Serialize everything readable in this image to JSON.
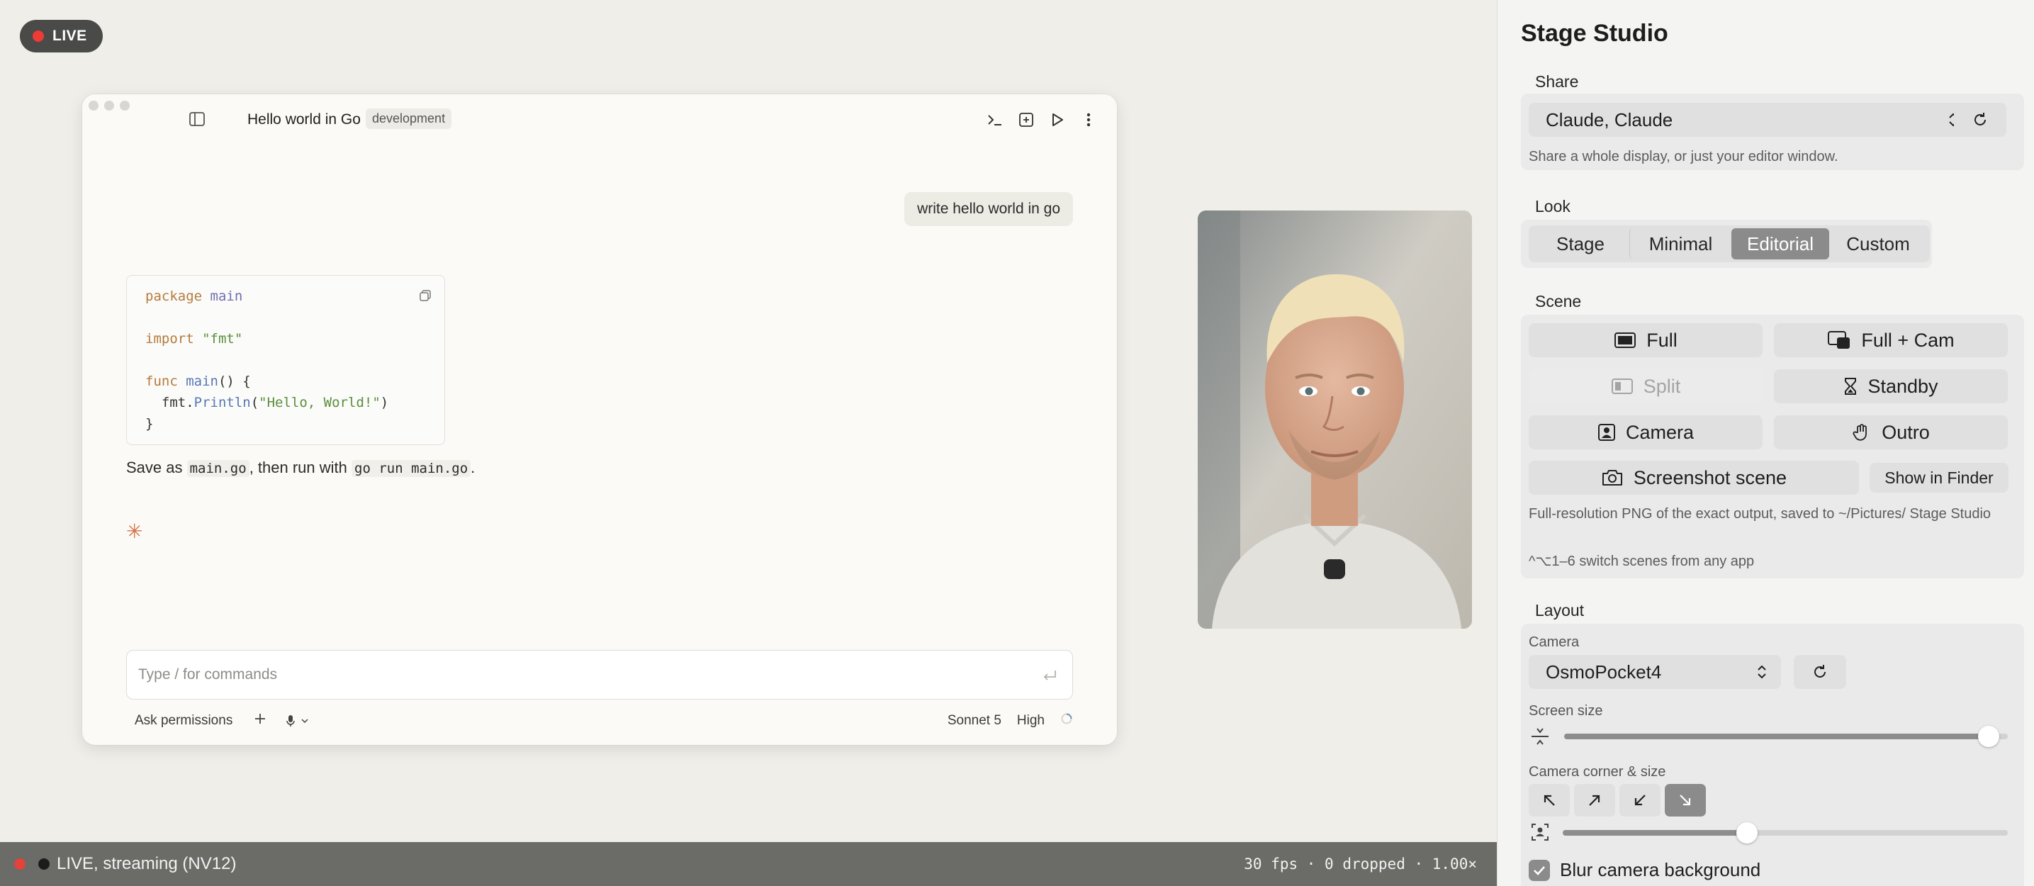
{
  "stage": {
    "live_badge": "LIVE",
    "window": {
      "title": "Hello world in Go",
      "env_badge": "development",
      "user_message": "write hello world in go",
      "code_lines": [
        [
          "package",
          " ",
          "main"
        ],
        [],
        [
          "import",
          " ",
          "\"fmt\""
        ],
        [],
        [
          "func",
          " ",
          "main",
          "() {"
        ],
        [
          "  fmt.",
          "Println",
          "(",
          "\"Hello, World!\"",
          ")"
        ],
        [
          "}"
        ]
      ],
      "answer": {
        "prefix": "Save as ",
        "file": "main.go",
        "middle": ", then run with ",
        "command": "go run main.go",
        "suffix": "."
      },
      "prompt_placeholder": "Type / for commands",
      "permissions_label": "Ask permissions",
      "model_label": "Sonnet 5",
      "effort_label": "High"
    },
    "status": {
      "label": "LIVE, streaming (NV12)",
      "stats": "30 fps · 0 dropped · 1.00×"
    }
  },
  "panel": {
    "title": "Stage Studio",
    "share": {
      "label": "Share",
      "selected": "Claude, Claude",
      "hint": "Share a whole display, or just your editor window."
    },
    "look": {
      "label": "Look",
      "options": [
        "Stage",
        "Minimal",
        "Editorial",
        "Custom"
      ],
      "active": "Editorial"
    },
    "scene": {
      "label": "Scene",
      "buttons": {
        "full": "Full",
        "full_cam": "Full + Cam",
        "split": "Split",
        "standby": "Standby",
        "camera": "Camera",
        "outro": "Outro"
      },
      "screenshot_label": "Screenshot scene",
      "show_in_finder": "Show in Finder",
      "screenshot_hint": "Full-resolution PNG of the exact output, saved to ~/Pictures/ Stage Studio",
      "shortcut_hint": "^⌥1–6 switch scenes from any app"
    },
    "layout": {
      "label": "Layout",
      "camera_label": "Camera",
      "camera_selected": "OsmoPocket4",
      "screen_size_label": "Screen size",
      "screen_size_fraction": 0.98,
      "corner_label": "Camera corner & size",
      "corner_active": "bottom-right",
      "camera_size_fraction": 0.41,
      "blur_label": "Blur camera background",
      "blur_checked": true
    }
  }
}
